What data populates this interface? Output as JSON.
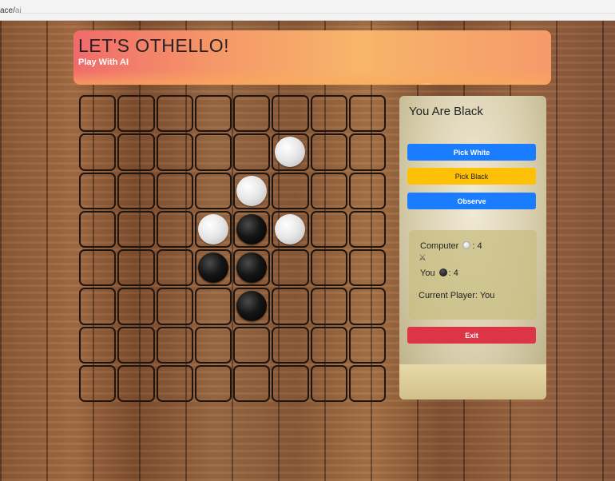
{
  "browser": {
    "url_prefix": "ace/",
    "url_rest": "ai"
  },
  "header": {
    "title": "LET'S OTHELLO!",
    "subtitle": "Play With AI"
  },
  "board": {
    "size": 8,
    "pieces": [
      [
        ".",
        ".",
        ".",
        ".",
        ".",
        ".",
        ".",
        "."
      ],
      [
        ".",
        ".",
        ".",
        ".",
        ".",
        "W",
        ".",
        "."
      ],
      [
        ".",
        ".",
        ".",
        ".",
        "W",
        ".",
        ".",
        "."
      ],
      [
        ".",
        ".",
        ".",
        "W",
        "B",
        "W",
        ".",
        "."
      ],
      [
        ".",
        ".",
        ".",
        "B",
        "B",
        ".",
        ".",
        "."
      ],
      [
        ".",
        ".",
        ".",
        ".",
        "B",
        ".",
        ".",
        "."
      ],
      [
        ".",
        ".",
        ".",
        ".",
        ".",
        ".",
        ".",
        "."
      ],
      [
        ".",
        ".",
        ".",
        ".",
        ".",
        ".",
        ".",
        "."
      ]
    ]
  },
  "panel": {
    "title": "You Are Black",
    "buttons": {
      "pick_white": "Pick White",
      "pick_black": "Pick Black",
      "observe": "Observe",
      "exit": "Exit"
    },
    "score": {
      "computer_label": "Computer",
      "computer_score": ": 4",
      "vs_icon": "⚔",
      "you_label": "You",
      "you_score": ": 4",
      "current_player": "Current Player: You"
    },
    "colors": {
      "blue": "#1a7cff",
      "yellow": "#ffc107",
      "red": "#dc3545"
    }
  }
}
